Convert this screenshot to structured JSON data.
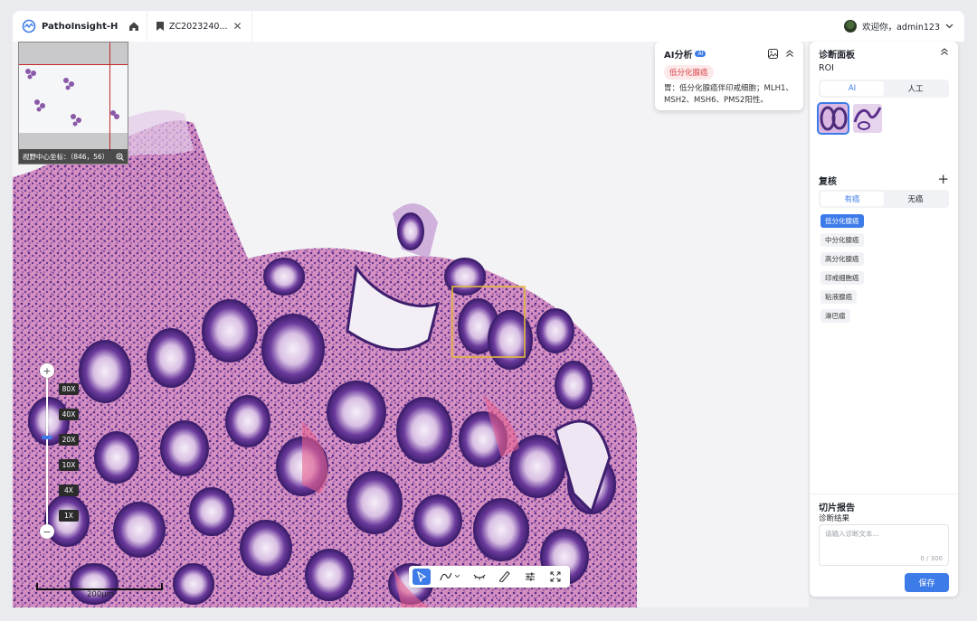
{
  "app": {
    "name": "PathoInsight-H"
  },
  "tab": {
    "label": "ZC2023240...",
    "close": "✕"
  },
  "user": {
    "greeting": "欢迎你，admin123"
  },
  "minimap": {
    "coords": "视野中心坐标：（846，56）"
  },
  "zoom": {
    "levels": [
      "80X",
      "40X",
      "20X",
      "10X",
      "4X",
      "1X"
    ],
    "plus": "+",
    "minus": "−",
    "current": "20X"
  },
  "scale": {
    "label": "200μm"
  },
  "ai_card": {
    "title": "AI分析",
    "badge": "AI",
    "tag": "低分化腺癌",
    "text": "胃：低分化腺癌伴印戒细胞；MLH1、MSH2、MSH6、PMS2阳性。"
  },
  "panel": {
    "title": "诊断面板",
    "roi_label": "ROI",
    "roi_tabs": [
      "AI",
      "人工"
    ],
    "review_title": "复核",
    "review_tabs": [
      "有癌",
      "无癌"
    ],
    "review_chips": [
      "低分化腺癌",
      "中分化腺癌",
      "高分化腺癌",
      "印戒细胞癌",
      "粘液腺癌",
      "淋巴瘤"
    ],
    "report_title": "切片报告",
    "result_label": "诊断结果",
    "input_placeholder": "请输入诊断文本...",
    "char_count": "0 / 300",
    "save_label": "保存"
  },
  "colors": {
    "accent": "#3d7be8",
    "tissue_dark": "#4b2a7a",
    "tissue_light": "#c9a6d6",
    "stroma": "#d98cb8"
  }
}
